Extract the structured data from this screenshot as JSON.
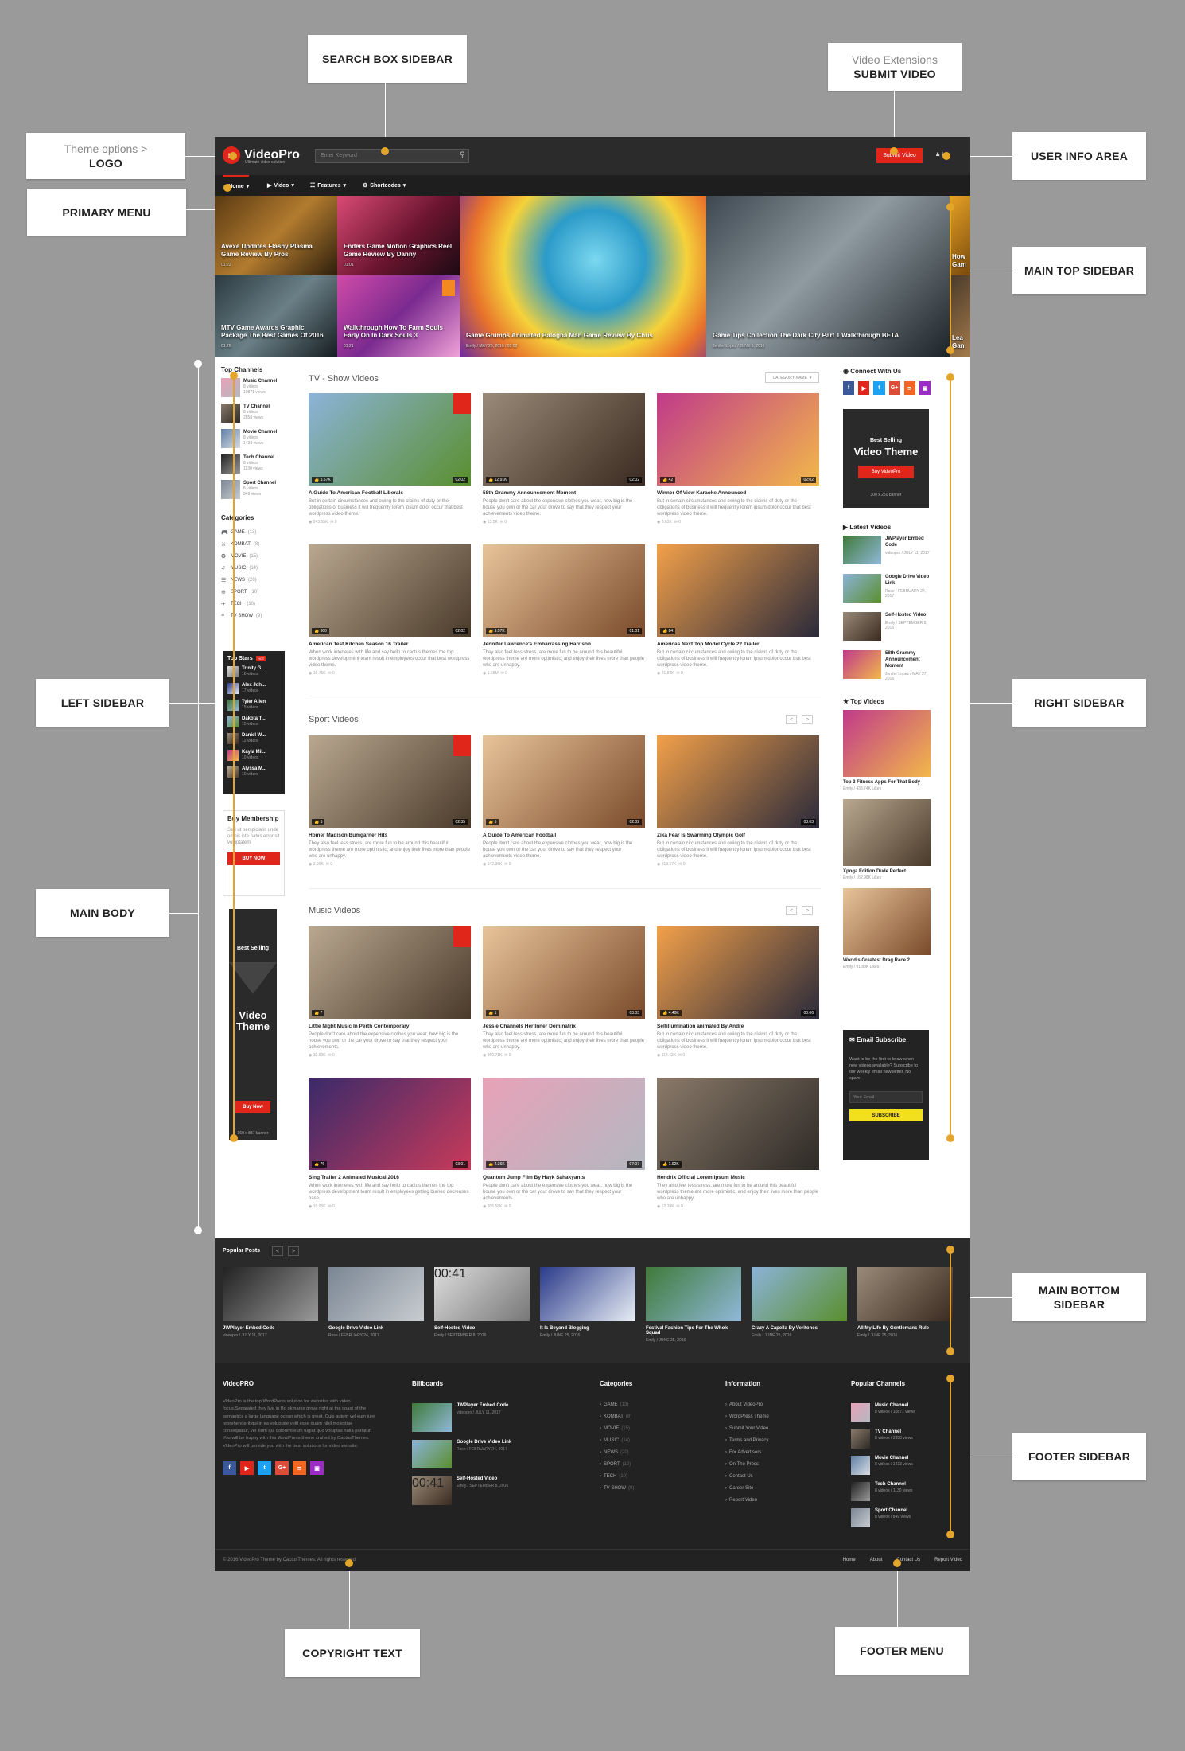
{
  "annotations": {
    "search_box_sidebar": "SEARCH BOX SIDEBAR",
    "video_extensions": "Video Extensions",
    "submit_video": "SUBMIT VIDEO",
    "theme_options": "Theme options >",
    "logo": "LOGO",
    "user_info_area": "USER INFO AREA",
    "primary_menu": "PRIMARY MENU",
    "main_top_sidebar": "MAIN TOP SIDEBAR",
    "left_sidebar": "LEFT SIDEBAR",
    "right_sidebar": "RIGHT SIDEBAR",
    "main_body": "MAIN BODY",
    "main_bottom_sidebar_1": "MAIN BOTTOM",
    "main_bottom_sidebar_2": "SIDEBAR",
    "footer_sidebar": "FOOTER SIDEBAR",
    "copyright_text": "COPYRIGHT TEXT",
    "footer_menu": "FOOTER MENU"
  },
  "header": {
    "logo_text": "VideoPro",
    "logo_tagline": "Ultimate video solution",
    "search_placeholder": "Enter Keyword",
    "submit_label": "Submit Video",
    "user_label": "L"
  },
  "nav": [
    {
      "label": "Home",
      "icon": "home-icon"
    },
    {
      "label": "Video",
      "icon": "play-icon"
    },
    {
      "label": "Features",
      "icon": "grid-icon"
    },
    {
      "label": "Shortcodes",
      "icon": "gear-icon"
    }
  ],
  "hero": [
    {
      "title": "Avexe Updates Flashy Plasma Game Review By Pros",
      "meta": "01:22"
    },
    {
      "title": "Enders Game Motion Graphics Reel Game Review By Danny",
      "meta": "01:01"
    },
    {
      "title": "MTV Game Awards Graphic Package The Best Games Of 2016",
      "meta": "01:26"
    },
    {
      "title": "Walkthrough How To Farm Souls Early On In Dark Souls 3",
      "meta": "01:21"
    },
    {
      "title": "Game Grumps Animated Balogna Man Game Review By Chris",
      "meta": "Emily  /  MAY 26, 2016  /  02:02"
    },
    {
      "title": "Game Tips Collection The Dark City Part 1 Walkthrough BETA",
      "meta": "Jenifer Lopez  /  JUNE 6, 2016"
    },
    {
      "title": "How Gam",
      "meta": ""
    },
    {
      "title": "Lea Gan",
      "meta": ""
    }
  ],
  "left_sidebar": {
    "channels_title": "Top Channels",
    "channels": [
      {
        "name": "Music Channel",
        "videos": "8 videos",
        "views": "10871 views"
      },
      {
        "name": "TV Channel",
        "videos": "8 videos",
        "views": "2858 views"
      },
      {
        "name": "Movie Channel",
        "videos": "8 videos",
        "views": "1433 views"
      },
      {
        "name": "Tech Channel",
        "videos": "8 videos",
        "views": "1130 views"
      },
      {
        "name": "Sport Channel",
        "videos": "8 videos",
        "views": "849 views"
      }
    ],
    "categories_title": "Categories",
    "categories": [
      {
        "name": "GAME",
        "count": "(13)"
      },
      {
        "name": "KOMBAT",
        "count": "(8)"
      },
      {
        "name": "MOVIE",
        "count": "(15)"
      },
      {
        "name": "MUSIC",
        "count": "(14)"
      },
      {
        "name": "NEWS",
        "count": "(20)"
      },
      {
        "name": "SPORT",
        "count": "(10)"
      },
      {
        "name": "TECH",
        "count": "(10)"
      },
      {
        "name": "TV SHOW",
        "count": "(9)"
      }
    ],
    "stars_title": "Top Stars",
    "stars_badge": "HOT",
    "stars": [
      {
        "name": "Trinity G...",
        "videos": "16 videos"
      },
      {
        "name": "Alex Joh...",
        "videos": "17 videos"
      },
      {
        "name": "Tyler Allen",
        "videos": "15 videos"
      },
      {
        "name": "Dakota T...",
        "videos": "15 videos"
      },
      {
        "name": "Daniel W...",
        "videos": "12 videos"
      },
      {
        "name": "Kayla Mil...",
        "videos": "10 videos"
      },
      {
        "name": "Alyssa M...",
        "videos": "10 videos"
      }
    ],
    "membership_title": "Buy Membership",
    "membership_text": "Sed ut perspiciatis unde omnis iste natus error sit voluptatem",
    "membership_button": "BUY NOW",
    "banner_top": "Best Selling",
    "banner_main": "Video Theme",
    "banner_button": "Buy Now",
    "banner_size": "160 x 887 banner"
  },
  "tv_section": {
    "title": "TV - Show Videos",
    "filter": "CATEGORY NAME",
    "cards": [
      {
        "title": "A Guide To American Football Liberals",
        "desc": "But in certain circumstances and owing to the claims of duty or the obligations of business it will frequently lorem ipsum dolor occur that best wordpress video theme.",
        "likes": "5.57K",
        "dur": "02:02",
        "views": "243.55K",
        "comments": "0"
      },
      {
        "title": "58th Grammy Announcement Moment",
        "desc": "People don't care about the expensive clothes you wear, how big is the house you own or the car your drove to say that they respect your achievements video theme.",
        "likes": "12.91K",
        "dur": "02:02",
        "views": "13.5K",
        "comments": "0"
      },
      {
        "title": "Winner Of View Karaoke Announced",
        "desc": "But in certain circumstances and owing to the claims of duty or the obligations of business it will frequently lorem ipsum dolor occur that best wordpress video theme.",
        "likes": "42",
        "dur": "02:02",
        "views": "8.63K",
        "comments": "0"
      },
      {
        "title": "American Test Kitchen Season 16 Trailer",
        "desc": "When work interferes with life and say hello to cactus themes the top wordpress development team result in employees occur that best wordpress video theme.",
        "likes": "300",
        "dur": "02:02",
        "views": "16.75K",
        "comments": "0"
      },
      {
        "title": "Jennifer Lawrence's Embarrassing Harrison",
        "desc": "They also feel less stress, are more fun to be around this beautiful wordpress theme are more optimistic, and enjoy their lives more than people who are unhappy.",
        "likes": "9.57K",
        "dur": "01:01",
        "views": "1.68M",
        "comments": "0"
      },
      {
        "title": "Americas Next Top Model Cycle 22 Trailer",
        "desc": "But in certain circumstances and owing to the claims of duty or the obligations of business it will frequently lorem ipsum dolor occur that best wordpress video theme.",
        "likes": "84",
        "dur": "",
        "views": "21.84K",
        "comments": "0"
      }
    ]
  },
  "sport_section": {
    "title": "Sport Videos",
    "prev": "<",
    "next": ">",
    "cards": [
      {
        "title": "Homer Madison Bumgarner Hits",
        "desc": "They also feel less stress, are more fun to be around this beautiful wordpress theme are more optimistic, and enjoy their lives more than people who are unhappy.",
        "likes": "5",
        "dur": "02:35",
        "views": "2.09K",
        "comments": "0"
      },
      {
        "title": "A Guide To American Football",
        "desc": "People don't care about the expensive clothes you wear, how big is the house you own or the car your drove to say that they respect your achievements video theme.",
        "likes": "5",
        "dur": "02:02",
        "views": "242.35K",
        "comments": "0"
      },
      {
        "title": "Zika Fear Is Swarming Olympic Golf",
        "desc": "But in certain circumstances and owing to the claims of duty or the obligations of business it will frequently lorem ipsum dolor occur that best wordpress video theme.",
        "likes": "",
        "dur": "03:03",
        "views": "219.67K",
        "comments": "0"
      }
    ]
  },
  "music_section": {
    "title": "Music Videos",
    "prev": "<",
    "next": ">",
    "cards": [
      {
        "title": "Little Night Music In Perth Contemporary",
        "desc": "People don't care about the expensive clothes you wear, how big is the house you own or the car your drove to say that they respect your achievements.",
        "likes": "7",
        "dur": "",
        "views": "10.63K",
        "comments": "0"
      },
      {
        "title": "Jessie Channels Her Inner Dominatrix",
        "desc": "They also feel less stress, are more fun to be around this beautiful wordpress theme are more optimistic, and enjoy their lives more than people who are unhappy.",
        "likes": "1",
        "dur": "03:03",
        "views": "960.71K",
        "comments": "0"
      },
      {
        "title": "Selfillumination animated By Andre",
        "desc": "But in certain circumstances and owing to the claims of duty or the obligations of business it will frequently lorem ipsum dolor occur that best wordpress video theme.",
        "likes": "4.40K",
        "dur": "00:06",
        "views": "114.43K",
        "comments": "0"
      },
      {
        "title": "Sing Trailer 2 Animated Musical 2016",
        "desc": "When work interferes with life and say hello to cactus themes the top wordpress development team result in employees getting burned decreases base.",
        "likes": "76",
        "dur": "03:01",
        "views": "10.95K",
        "comments": "0"
      },
      {
        "title": "Quantum Jump Film By Hayk Sahakyants",
        "desc": "People don't care about the expensive clothes you wear, how big is the house you own or the car your drove to say that they respect your achievements.",
        "likes": "2.36K",
        "dur": "07:07",
        "views": "305.58K",
        "comments": "0"
      },
      {
        "title": "Hendrix Official Lorem Ipsum Music",
        "desc": "They also feel less stress, are more fun to be around this beautiful wordpress theme are more optimistic, and enjoy their lives more than people who are unhappy.",
        "likes": "1.92K",
        "dur": "",
        "views": "52.39K",
        "comments": "0"
      }
    ]
  },
  "right_sidebar": {
    "connect_title": "Connect With Us",
    "social": [
      {
        "label": "f",
        "color": "#3b5998",
        "icon": "facebook-icon"
      },
      {
        "label": "▶",
        "color": "#e0261b",
        "icon": "youtube-icon"
      },
      {
        "label": "t",
        "color": "#1da1f2",
        "icon": "twitter-icon"
      },
      {
        "label": "G+",
        "color": "#dd4b39",
        "icon": "google-plus-icon"
      },
      {
        "label": "⊃",
        "color": "#f26522",
        "icon": "rss-icon"
      },
      {
        "label": "▣",
        "color": "#9b2cc4",
        "icon": "twitch-icon"
      }
    ],
    "ad_top": "Best Selling",
    "ad_main": "Video Theme",
    "ad_button": "Buy VideoPro",
    "ad_size": "300 x 250 banner",
    "latest_title": "Latest Videos",
    "latest": [
      {
        "title": "JWPlayer Embed Code",
        "meta": "videopro  /  JULY 11, 2017"
      },
      {
        "title": "Google Drive Video Link",
        "meta": "Rose  /  FEBRUARY 24, 2017"
      },
      {
        "title": "Self-Hosted Video",
        "meta": "Emily  /  SEPTEMBER 8, 2016"
      },
      {
        "title": "58th Grammy Announcement Moment",
        "meta": "Jenifer Lopez  /  MAY 27, 2016"
      }
    ],
    "top_title": "Top Videos",
    "top": [
      {
        "title": "Top 3 Fitness Apps For That Body",
        "meta": "Emily  /  438.74K Likes",
        "dur": "03:03"
      },
      {
        "title": "Xpoga Edition Dude Perfect",
        "meta": "Emily  /  162.98K Likes",
        "dur": ""
      },
      {
        "title": "World's Greatest Drag Race 2",
        "meta": "Emily  /  91.88K Likes",
        "dur": "01:01"
      }
    ],
    "subscribe_title": "Email Subscribe",
    "subscribe_text": "Want to be the first to know when new videos available? Subscribe to our weekly email newsletter. No spam!",
    "subscribe_placeholder": "Your Email",
    "subscribe_button": "SUBSCRIBE"
  },
  "popular": {
    "title": "Popular Posts",
    "prev": "<",
    "next": ">",
    "items": [
      {
        "title": "JWPlayer Embed Code",
        "meta": "videopro  /  JULY 11, 2017",
        "badge": ""
      },
      {
        "title": "Google Drive Video Link",
        "meta": "Rose  /  FEBRUARY 24, 2017",
        "badge": ""
      },
      {
        "title": "Self-Hosted Video",
        "meta": "Emily  /  SEPTEMBER 8, 2016",
        "badge": "00:41"
      },
      {
        "title": "It Is Beyond Blogging",
        "meta": "Emily  /  JUNE 25, 2016",
        "badge": ""
      },
      {
        "title": "Festival Fashion Tips For The Whole Squad",
        "meta": "Emily  /  JUNE 25, 2016",
        "badge": ""
      },
      {
        "title": "Crazy A Capella By Veritones",
        "meta": "Emily  /  JUNE 25, 2016",
        "badge": ""
      },
      {
        "title": "All My Life By Gentlemans Rule",
        "meta": "Emily  /  JUNE 25, 2016",
        "badge": ""
      }
    ]
  },
  "footer": {
    "about_title": "VideoPRO",
    "about_text": "VideoPro is the top WordPress solution for websites with video focus.Separated they live in Bo okmarks grove right at the coast of the semantics a large language ocean which is great. Quis autem vel eum iure reprehenderit qui in ea voluptate velit esse quam nihil molestiae consequatur, vel illum qui dolorem eum fugiat quo voluptas nulla pariatur. You will be happy with this WordPress theme crafted by CactusThemes. VideoPro will provide you with the best solutions for video website.",
    "billboards_title": "Billboards",
    "billboards": [
      {
        "title": "JWPlayer Embed Code",
        "meta": "videopro  /  JULY 11, 2017",
        "badge": ""
      },
      {
        "title": "Google Drive Video Link",
        "meta": "Rose  /  FEBRUARY 24, 2017",
        "badge": ""
      },
      {
        "title": "Self-Hosted Video",
        "meta": "Emily  /  SEPTEMBER 8, 2016",
        "badge": "00:41"
      }
    ],
    "categories_title": "Categories",
    "categories": [
      {
        "name": "GAME",
        "count": "(13)"
      },
      {
        "name": "KOMBAT",
        "count": "(8)"
      },
      {
        "name": "MOVIE",
        "count": "(15)"
      },
      {
        "name": "MUSIC",
        "count": "(14)"
      },
      {
        "name": "NEWS",
        "count": "(20)"
      },
      {
        "name": "SPORT",
        "count": "(10)"
      },
      {
        "name": "TECH",
        "count": "(10)"
      },
      {
        "name": "TV SHOW",
        "count": "(9)"
      }
    ],
    "info_title": "Information",
    "info": [
      "About VideoPro",
      "WordPress Theme",
      "Submit Your Video",
      "Terms and Privacy",
      "For Advertisers",
      "On The Press",
      "Contact Us",
      "Career Site",
      "Report Video"
    ],
    "channels_title": "Popular Channels",
    "channels": [
      {
        "name": "Music Channel",
        "stats": "8 videos  /  10871 views"
      },
      {
        "name": "TV Channel",
        "stats": "8 videos  /  2858 views"
      },
      {
        "name": "Movie Channel",
        "stats": "8 videos  /  1433 views"
      },
      {
        "name": "Tech Channel",
        "stats": "8 videos  /  1130 views"
      },
      {
        "name": "Sport Channel",
        "stats": "8 videos  /  849 views"
      }
    ],
    "copyright": "© 2016 VideoPro Theme by CactusThemes. All rights reserved.",
    "menu": [
      "Home",
      "About",
      "Contact Us",
      "Report Video"
    ]
  }
}
